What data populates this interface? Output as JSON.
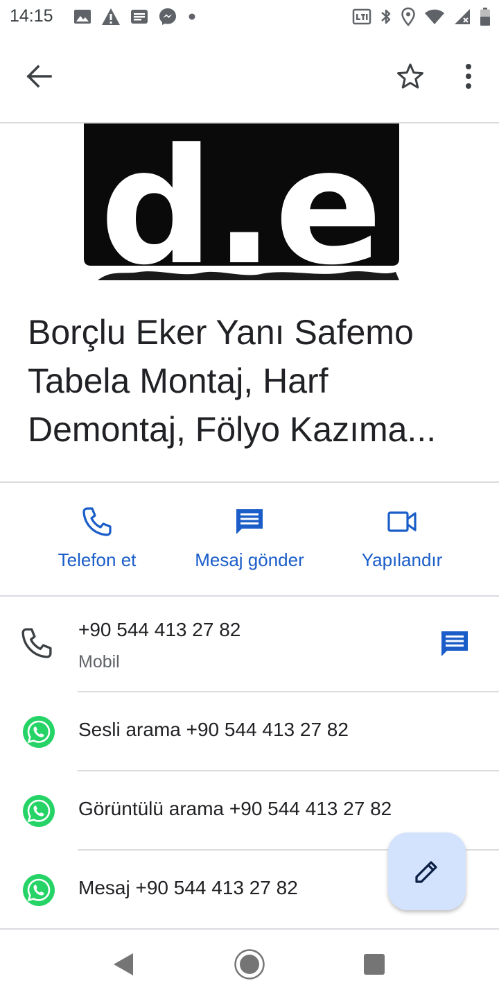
{
  "status_bar": {
    "time": "14:15",
    "left_icons": [
      "image-icon",
      "warning-icon",
      "news-icon",
      "messenger-icon",
      "dot-icon"
    ],
    "right_icons": [
      "volte-icon",
      "bluetooth-icon",
      "location-icon",
      "wifi-icon",
      "signal-icon",
      "battery-icon"
    ]
  },
  "app_bar": {
    "icons": [
      "back-arrow-icon",
      "star-outline-icon",
      "more-vert-icon"
    ]
  },
  "contact": {
    "name": "Borçlu Eker Yanı Safemo Tabela Montaj, Harf Demontaj, Fölyo Kazıma...",
    "photo_logo_text": "d.e"
  },
  "actions": [
    {
      "label": "Telefon et",
      "icon": "phone-icon"
    },
    {
      "label": "Mesaj gönder",
      "icon": "message-icon"
    },
    {
      "label": "Yapılandır",
      "icon": "video-call-icon"
    }
  ],
  "phone": {
    "number": "+90 544 413 27 82",
    "type": "Mobil"
  },
  "whatsapp_rows": [
    {
      "label": "Sesli arama +90 544 413 27 82"
    },
    {
      "label": "Görüntülü arama +90 544 413 27 82"
    },
    {
      "label": "Mesaj +90 544 413 27 82"
    }
  ],
  "colors": {
    "accent_blue": "#1a5dc8",
    "whatsapp_green": "#25d366",
    "fab_background": "#d3e3fd",
    "divider": "#dadce0"
  },
  "fab": {
    "icon": "edit-pencil-icon"
  },
  "nav_bar": {
    "icons": [
      "nav-back-icon",
      "nav-home-icon",
      "nav-recents-icon"
    ]
  }
}
